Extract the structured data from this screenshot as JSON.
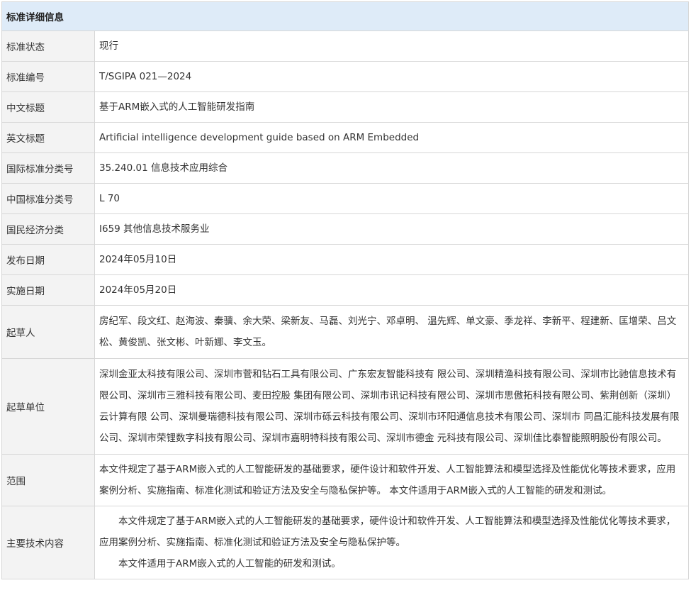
{
  "header": {
    "title": "标准详细信息"
  },
  "rows": [
    {
      "label": "标准状态",
      "value": "现行"
    },
    {
      "label": "标准编号",
      "value": "T/SGIPA 021—2024"
    },
    {
      "label": "中文标题",
      "value": "基于ARM嵌入式的人工智能研发指南"
    },
    {
      "label": "英文标题",
      "value": "Artificial intelligence development guide based on ARM Embedded"
    },
    {
      "label": "国际标准分类号",
      "value": "35.240.01 信息技术应用综合"
    },
    {
      "label": "中国标准分类号",
      "value": "L 70"
    },
    {
      "label": "国民经济分类",
      "value": "I659 其他信息技术服务业"
    },
    {
      "label": "发布日期",
      "value": "2024年05月10日"
    },
    {
      "label": "实施日期",
      "value": "2024年05月20日"
    },
    {
      "label": "起草人",
      "value": "房纪军、段文红、赵海波、秦骥、余大荣、梁新友、马磊、刘光宁、邓卓明、 温先辉、单文豪、季龙祥、李新平、程建新、匡增荣、吕文松、黄俊凯、张文彬、叶新娜、李文玉。"
    },
    {
      "label": "起草单位",
      "value": "深圳金亚太科技有限公司、深圳市菅和钻石工具有限公司、广东宏友智能科技有 限公司、深圳精渔科技有限公司、深圳市比驰信息技术有限公司、深圳市三雅科技有限公司、麦田控股 集团有限公司、深圳市讯记科技有限公司、深圳市思傲拓科技有限公司、紫荆创新（深圳）云计算有限 公司、深圳曼瑞德科技有限公司、深圳市砾云科技有限公司、深圳市环阳通信息技术有限公司、深圳市 同昌汇能科技发展有限公司、深圳市荣锂数字科技有限公司、深圳市嘉明特科技有限公司、深圳市德金 元科技有限公司、深圳佳比泰智能照明股份有限公司。"
    },
    {
      "label": "范围",
      "value": "本文件规定了基于ARM嵌入式的人工智能研发的基础要求，硬件设计和软件开发、人工智能算法和模型选择及性能优化等技术要求，应用案例分析、实施指南、标准化测试和验证方法及安全与隐私保护等。 本文件适用于ARM嵌入式的人工智能的研发和测试。"
    },
    {
      "label": "主要技术内容",
      "paragraphs": [
        "本文件规定了基于ARM嵌入式的人工智能研发的基础要求，硬件设计和软件开发、人工智能算法和模型选择及性能优化等技术要求，应用案例分析、实施指南、标准化测试和验证方法及安全与隐私保护等。",
        "本文件适用于ARM嵌入式的人工智能的研发和测试。"
      ]
    }
  ]
}
